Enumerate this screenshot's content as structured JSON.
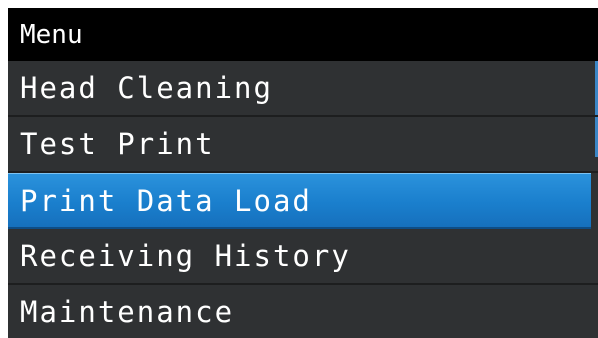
{
  "header": {
    "title": "Menu"
  },
  "menu": {
    "items": [
      {
        "label": "Head Cleaning",
        "selected": false
      },
      {
        "label": "Test Print",
        "selected": false
      },
      {
        "label": "Print Data Load",
        "selected": true
      },
      {
        "label": "Receiving History",
        "selected": false
      },
      {
        "label": "Maintenance",
        "selected": false
      }
    ]
  },
  "colors": {
    "background": "#2f3133",
    "titlebar": "#000000",
    "selection": "#1a7fcd",
    "text": "#ffffff"
  }
}
